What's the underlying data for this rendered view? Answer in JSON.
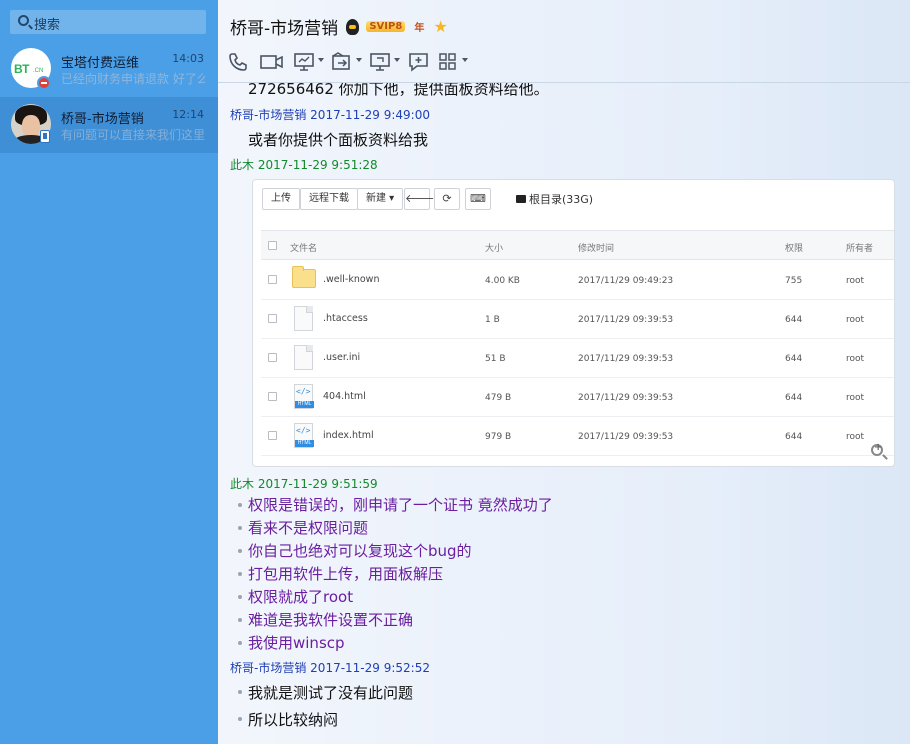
{
  "sidebar": {
    "search_placeholder": "搜索",
    "conversations": [
      {
        "name": "宝塔付费运维",
        "time": "14:03",
        "preview": "已经向财务申请退款 好了么",
        "avatar_text": "BT",
        "avatar_sub": ".CN"
      },
      {
        "name": "桥哥-市场营销",
        "time": "12:14",
        "preview": "有问题可以直接来我们这里",
        "selected": true
      }
    ]
  },
  "header": {
    "title": "桥哥-市场营销",
    "vip_badge": "SVIP8",
    "year_badge": "年"
  },
  "toolbar": [
    "phone-icon",
    "video-icon",
    "screen-share-icon",
    "transfer-icon",
    "remote-desktop-icon",
    "add-message-icon",
    "apps-grid-icon"
  ],
  "messages": {
    "partial_line": "272656462 你加下他，提供面板资料给他。",
    "m1": {
      "sender": "桥哥-市场营销",
      "time": "2017-11-29 9:49:00",
      "lines": [
        "或者你提供个面板资料给我"
      ]
    },
    "m2": {
      "sender": "此木",
      "time": "2017-11-29 9:51:28"
    },
    "m3": {
      "sender": "此木",
      "time": "2017-11-29 9:51:59",
      "lines": [
        "权限是错误的，刚申请了一个证书 竟然成功了",
        "看来不是权限问题",
        "你自己也绝对可以复现这个bug的",
        "打包用软件上传，用面板解压",
        "权限就成了root",
        "难道是我软件设置不正确",
        "我使用winscp"
      ]
    },
    "m4": {
      "sender": "桥哥-市场营销",
      "time": "2017-11-29 9:52:52",
      "lines": [
        "我就是测试了没有此问题",
        "所以比较纳闷"
      ]
    }
  },
  "file_manager": {
    "buttons": {
      "upload": "上传",
      "remote_download": "远程下载",
      "new": "新建 ▾",
      "back": "🡐",
      "refresh": "⟳",
      "terminal": "⌨"
    },
    "root_label": "根目录(33G)",
    "columns": [
      "文件名",
      "大小",
      "修改时间",
      "权限",
      "所有者"
    ],
    "rows": [
      {
        "name": ".well-known",
        "size": "4.00 KB",
        "mtime": "2017/11/29 09:49:23",
        "perm": "755",
        "owner": "root",
        "kind": "folder"
      },
      {
        "name": ".htaccess",
        "size": "1 B",
        "mtime": "2017/11/29 09:39:53",
        "perm": "644",
        "owner": "root",
        "kind": "file"
      },
      {
        "name": ".user.ini",
        "size": "51 B",
        "mtime": "2017/11/29 09:39:53",
        "perm": "644",
        "owner": "root",
        "kind": "file"
      },
      {
        "name": "404.html",
        "size": "479 B",
        "mtime": "2017/11/29 09:39:53",
        "perm": "644",
        "owner": "root",
        "kind": "html"
      },
      {
        "name": "index.html",
        "size": "979 B",
        "mtime": "2017/11/29 09:39:53",
        "perm": "644",
        "owner": "root",
        "kind": "html"
      }
    ],
    "html_icon_tag": "</>",
    "html_icon_label": "HTML"
  }
}
